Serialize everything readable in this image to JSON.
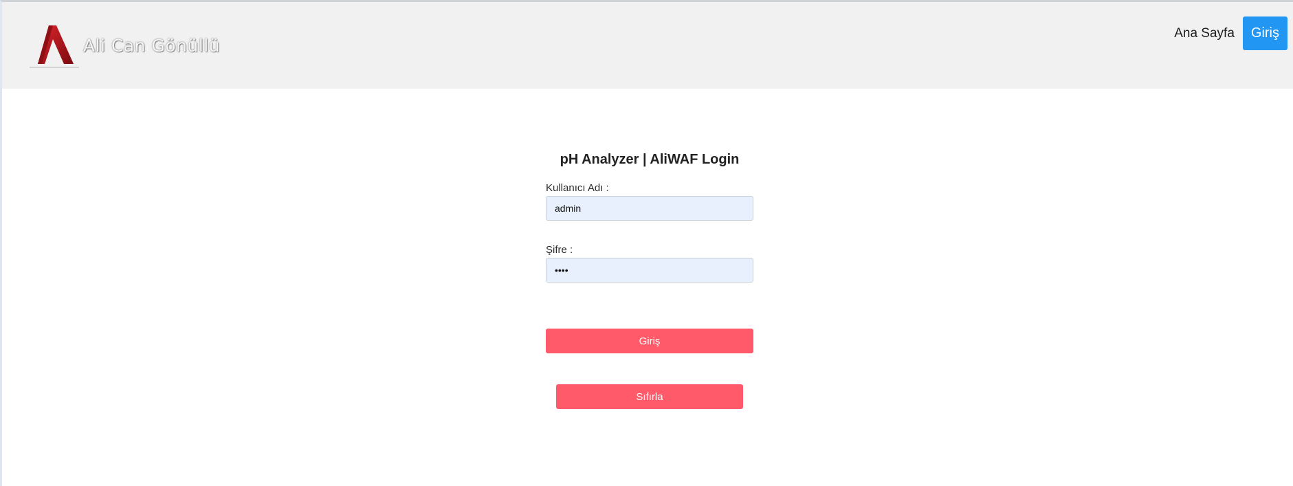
{
  "header": {
    "brand_name": "Ali Can Gönüllü",
    "nav": {
      "home_label": "Ana Sayfa",
      "login_label": "Giriş"
    }
  },
  "login_form": {
    "title": "pH Analyzer | AliWAF Login",
    "username": {
      "label": "Kullanıcı Adı :",
      "value": "admin"
    },
    "password": {
      "label": "Şifre :",
      "value": "1234"
    },
    "submit_label": "Giriş",
    "reset_label": "Sıfırla"
  },
  "colors": {
    "navbar_bg": "#f1f1f1",
    "nav_button": "#2196f3",
    "action_button": "#ff5a6a",
    "input_autofill_bg": "#e8f0fe",
    "logo_red": "#b5151b"
  }
}
